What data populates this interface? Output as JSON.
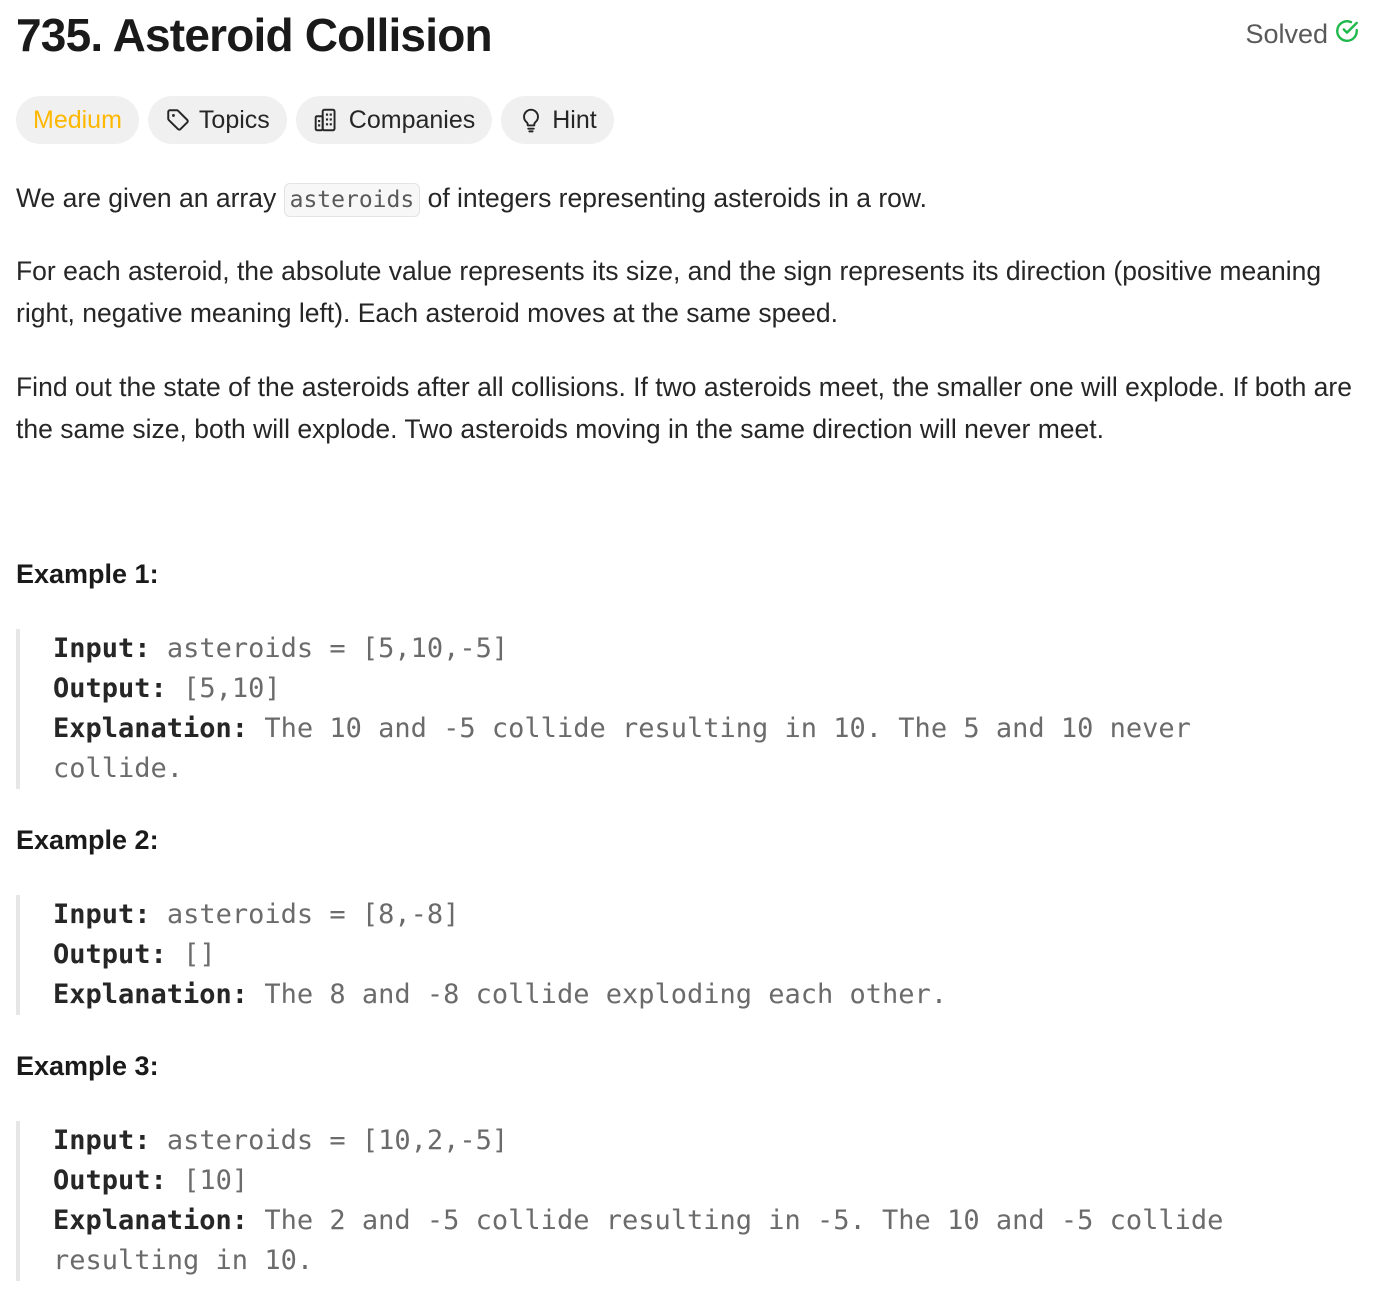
{
  "problem": {
    "title": "735. Asteroid Collision",
    "status": "Solved",
    "status_color": "#1fb84a"
  },
  "tags": {
    "difficulty": "Medium",
    "difficulty_color": "#ffb800",
    "topics": "Topics",
    "companies": "Companies",
    "hint": "Hint"
  },
  "description": {
    "p1_before": "We are given an array ",
    "p1_code": "asteroids",
    "p1_after": " of integers representing asteroids in a row.",
    "p2": "For each asteroid, the absolute value represents its size, and the sign represents its direction (positive meaning right, negative meaning left). Each asteroid moves at the same speed.",
    "p3": "Find out the state of the asteroids after all collisions. If two asteroids meet, the smaller one will explode. If both are the same size, both will explode. Two asteroids moving in the same direction will never meet."
  },
  "examples": [
    {
      "heading": "Example 1:",
      "input_label": "Input:",
      "input": "asteroids = [5,10,-5]",
      "output_label": "Output:",
      "output": "[5,10]",
      "explanation_label": "Explanation:",
      "explanation": "The 10 and -5 collide resulting in 10. The 5 and 10 never collide."
    },
    {
      "heading": "Example 2:",
      "input_label": "Input:",
      "input": "asteroids = [8,-8]",
      "output_label": "Output:",
      "output": "[]",
      "explanation_label": "Explanation:",
      "explanation": "The 8 and -8 collide exploding each other."
    },
    {
      "heading": "Example 3:",
      "input_label": "Input:",
      "input": "asteroids = [10,2,-5]",
      "output_label": "Output:",
      "output": "[10]",
      "explanation_label": "Explanation:",
      "explanation": "The 2 and -5 collide resulting in -5. The 10 and -5 collide resulting in 10."
    }
  ]
}
